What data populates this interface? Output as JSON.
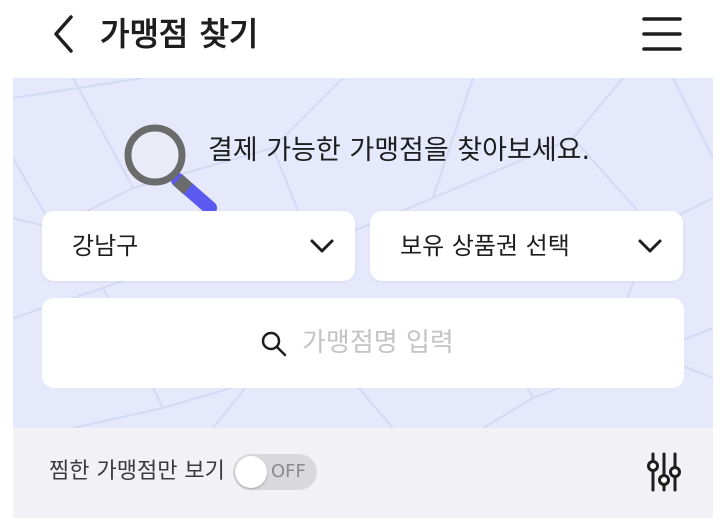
{
  "header": {
    "title": "가맹점 찾기",
    "back_icon": "chevron-left-icon",
    "menu_icon": "hamburger-menu-icon"
  },
  "hero": {
    "message": "결제 가능한 가맹점을 찾아보세요.",
    "illustration_icon": "magnifier-illustration-icon",
    "background_color": "#e6e9fb",
    "accent_color": "#5a5af0"
  },
  "filters": {
    "district": {
      "value": "강남구",
      "icon": "chevron-down-icon"
    },
    "voucher": {
      "value": "보유 상품권 선택",
      "icon": "chevron-down-icon"
    }
  },
  "search": {
    "placeholder": "가맹점명 입력",
    "value": "",
    "icon": "search-icon"
  },
  "bottom_bar": {
    "favorites_label": "찜한 가맹점만 보기",
    "toggle_state": "OFF",
    "filter_icon": "sliders-icon"
  }
}
